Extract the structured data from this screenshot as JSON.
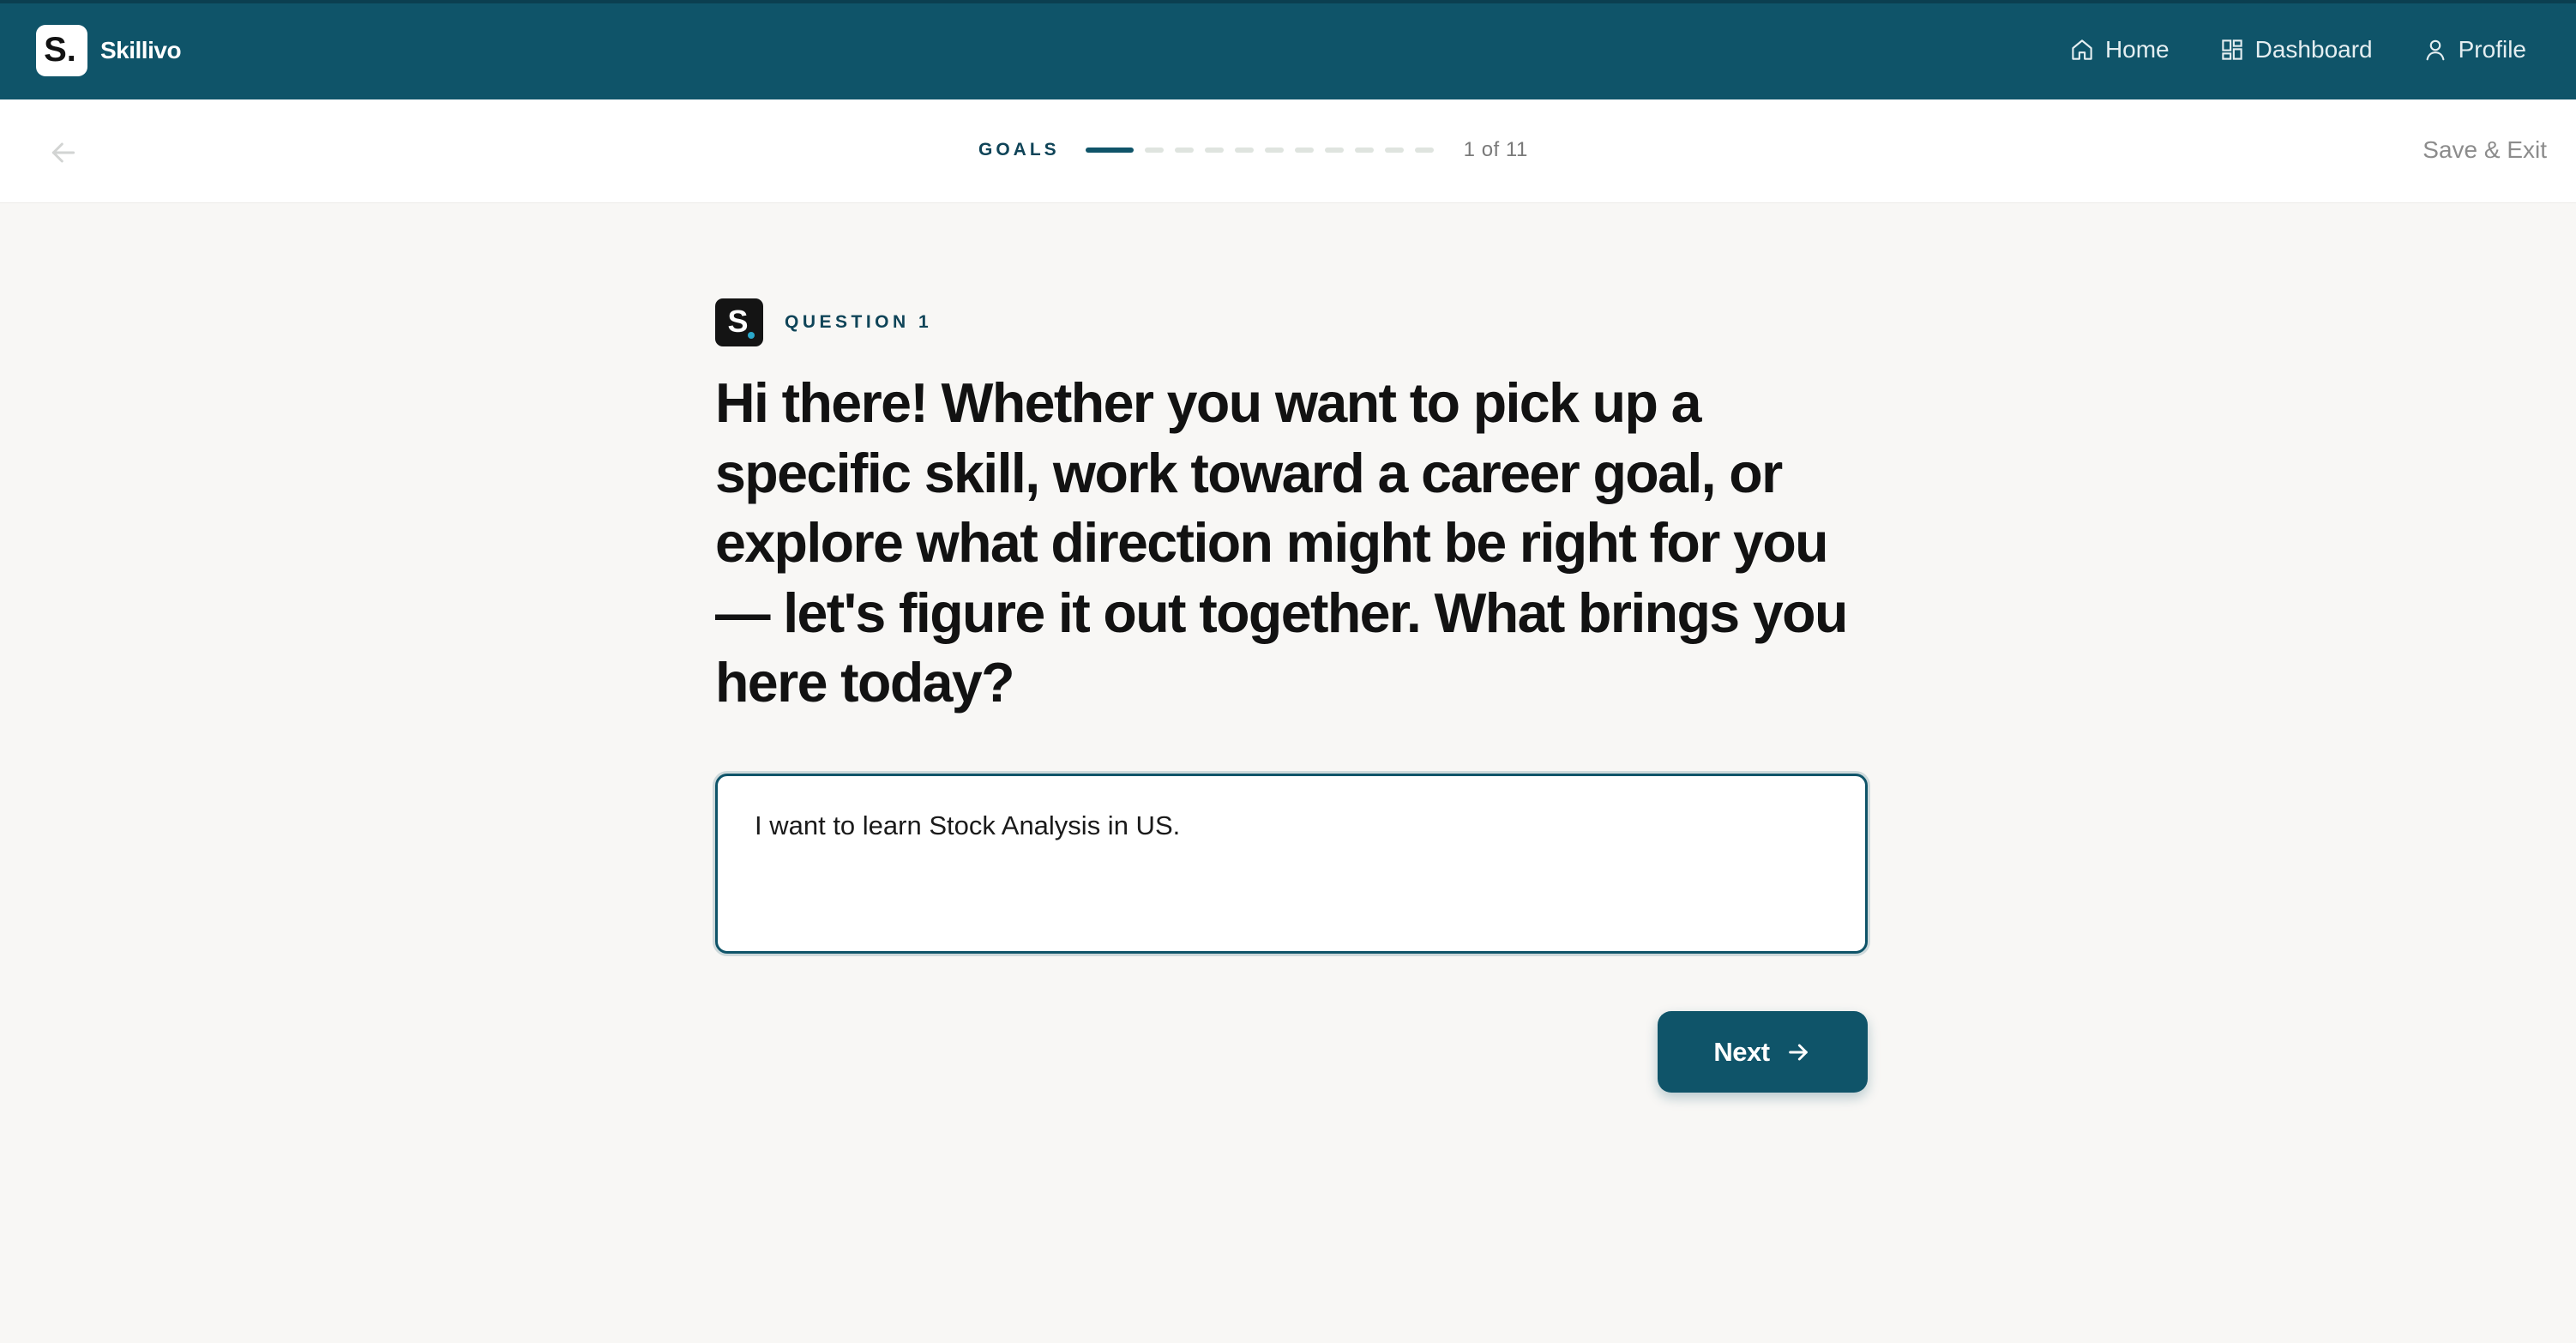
{
  "app": {
    "name": "Skillivo",
    "logo_letter": "S."
  },
  "nav": {
    "items": [
      {
        "label": "Home",
        "icon": "home-icon"
      },
      {
        "label": "Dashboard",
        "icon": "dashboard-icon"
      },
      {
        "label": "Profile",
        "icon": "user-icon"
      }
    ]
  },
  "progress": {
    "section_label": "GOALS",
    "current_step": 1,
    "total_steps": 11,
    "counter_text": "1 of 11",
    "save_exit_label": "Save & Exit"
  },
  "question": {
    "tag_label": "QUESTION 1",
    "logo_letter": "S",
    "text": "Hi there! Whether you want to pick up a specific skill, work toward a career goal, or explore what direction might be right for you — let's figure it out together. What brings you here today?",
    "answer_value": "I want to learn Stock Analysis in US.",
    "next_label": "Next"
  },
  "colors": {
    "brand": "#0f5469",
    "background": "#f8f7f5",
    "step_inactive": "#dfe4df"
  }
}
